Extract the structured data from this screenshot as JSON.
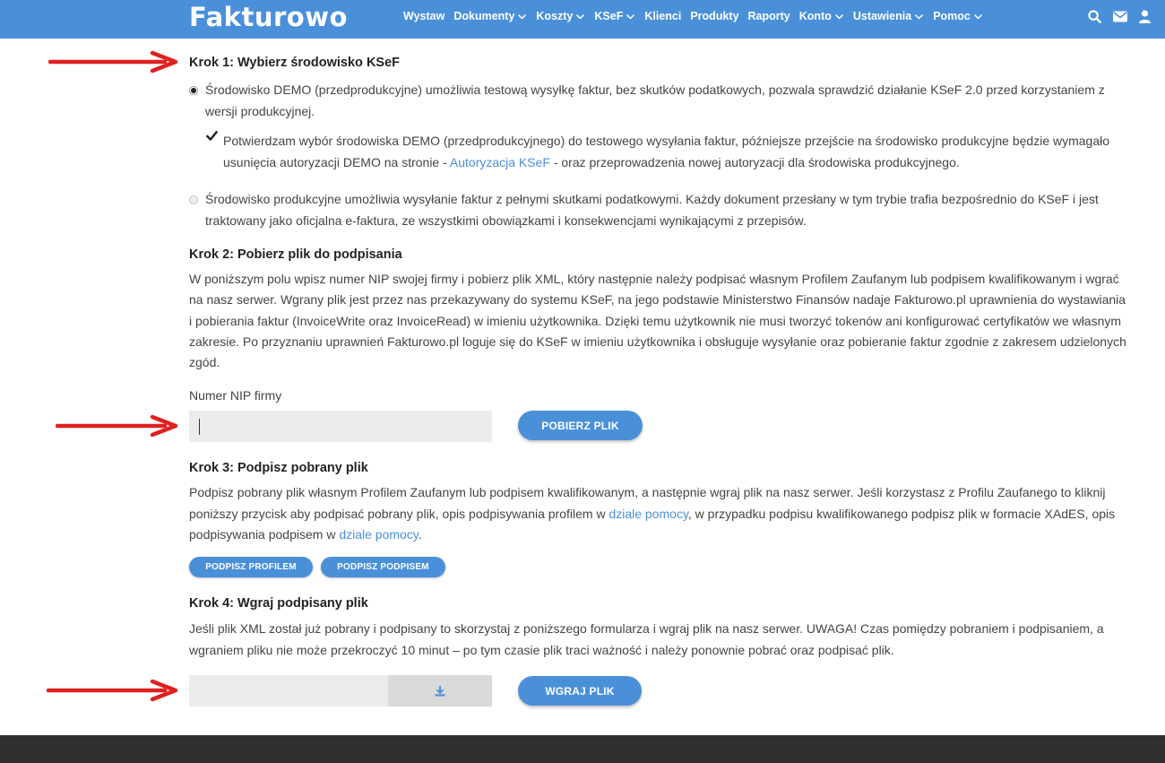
{
  "colors": {
    "brand": "#4a90d9",
    "footer": "#2f2f2f",
    "annotation_arrow": "#e02020",
    "link": "#4a90d9"
  },
  "header": {
    "logo": "Fakturowo",
    "nav": [
      {
        "label": "Wystaw",
        "dropdown": false
      },
      {
        "label": "Dokumenty",
        "dropdown": true
      },
      {
        "label": "Koszty",
        "dropdown": true
      },
      {
        "label": "KSeF",
        "dropdown": true
      },
      {
        "label": "Klienci",
        "dropdown": false
      },
      {
        "label": "Produkty",
        "dropdown": false
      },
      {
        "label": "Raporty",
        "dropdown": false
      },
      {
        "label": "Konto",
        "dropdown": true
      },
      {
        "label": "Ustawienia",
        "dropdown": true
      },
      {
        "label": "Pomoc",
        "dropdown": true
      }
    ],
    "icons": [
      "search-icon",
      "envelope-icon",
      "user-icon"
    ]
  },
  "step1": {
    "title": "Krok 1: Wybierz środowisko KSeF",
    "option_demo": "Środowisko DEMO (przedprodukcyjne) umożliwia testową wysyłkę faktur, bez skutków podatkowych, pozwala sprawdzić działanie KSeF 2.0 przed korzystaniem z wersji produkcyjnej.",
    "confirm_before": "Potwierdzam wybór środowiska DEMO (przedprodukcyjnego) do testowego wysyłania faktur, późniejsze przejście na środowisko produkcyjne będzie wymagało usunięcia autoryzacji DEMO na stronie - ",
    "confirm_link": "Autoryzacja KSeF",
    "confirm_after": " - oraz przeprowadzenia nowej autoryzacji dla środowiska produkcyjnego.",
    "option_prod": "Środowisko produkcyjne umożliwia wysyłanie faktur z pełnymi skutkami podatkowymi. Każdy dokument przesłany w tym trybie trafia bezpośrednio do KSeF i jest traktowany jako oficjalna e-faktura, ze wszystkimi obowiązkami i konsekwencjami wynikającymi z przepisów.",
    "selected": "demo"
  },
  "step2": {
    "title": "Krok 2: Pobierz plik do podpisania",
    "text": "W poniższym polu wpisz numer NIP swojej firmy i pobierz plik XML, który następnie należy podpisać własnym Profilem Zaufanym lub podpisem kwalifikowanym i wgrać na nasz serwer. Wgrany plik jest przez nas przekazywany do systemu KSeF, na jego podstawie Ministerstwo Finansów nadaje Fakturowo.pl uprawnienia do wystawiania i pobierania faktur (InvoiceWrite oraz InvoiceRead) w imieniu użytkownika. Dzięki temu użytkownik nie musi tworzyć tokenów ani konfigurować certyfikatów we własnym zakresie. Po przyznaniu uprawnień Fakturowo.pl loguje się do KSeF w imieniu użytkownika i obsługuje wysyłanie oraz pobieranie faktur zgodnie z zakresem udzielonych zgód.",
    "field_label": "Numer NIP firmy",
    "nip_value": "",
    "button": "POBIERZ PLIK"
  },
  "step3": {
    "title": "Krok 3: Podpisz pobrany plik",
    "text_1": "Podpisz pobrany plik własnym Profilem Zaufanym lub podpisem kwalifikowanym, a następnie wgraj plik na nasz serwer. Jeśli korzystasz z Profilu Zaufanego to kliknij poniższy przycisk aby podpisać pobrany plik, opis podpisywania profilem w ",
    "link_1": "dziale pomocy",
    "text_2": ", w przypadku podpisu kwalifikowanego podpisz plik w formacie XAdES, opis podpisywania podpisem w ",
    "link_2": "dziale pomocy",
    "text_3": ".",
    "button_profile": "PODPISZ PROFILEM",
    "button_signature": "PODPISZ PODPISEM"
  },
  "step4": {
    "title": "Krok 4: Wgraj podpisany plik",
    "text": "Jeśli plik XML został już pobrany i podpisany to skorzystaj z poniższego formularza i wgraj plik na nasz serwer. UWAGA! Czas pomiędzy pobraniem i podpisaniem, a wgraniem pliku nie może przekroczyć 10 minut – po tym czasie plik traci ważność i należy ponownie pobrać oraz podpisać plik.",
    "file_icon": "upload-icon",
    "button": "WGRAJ PLIK"
  }
}
